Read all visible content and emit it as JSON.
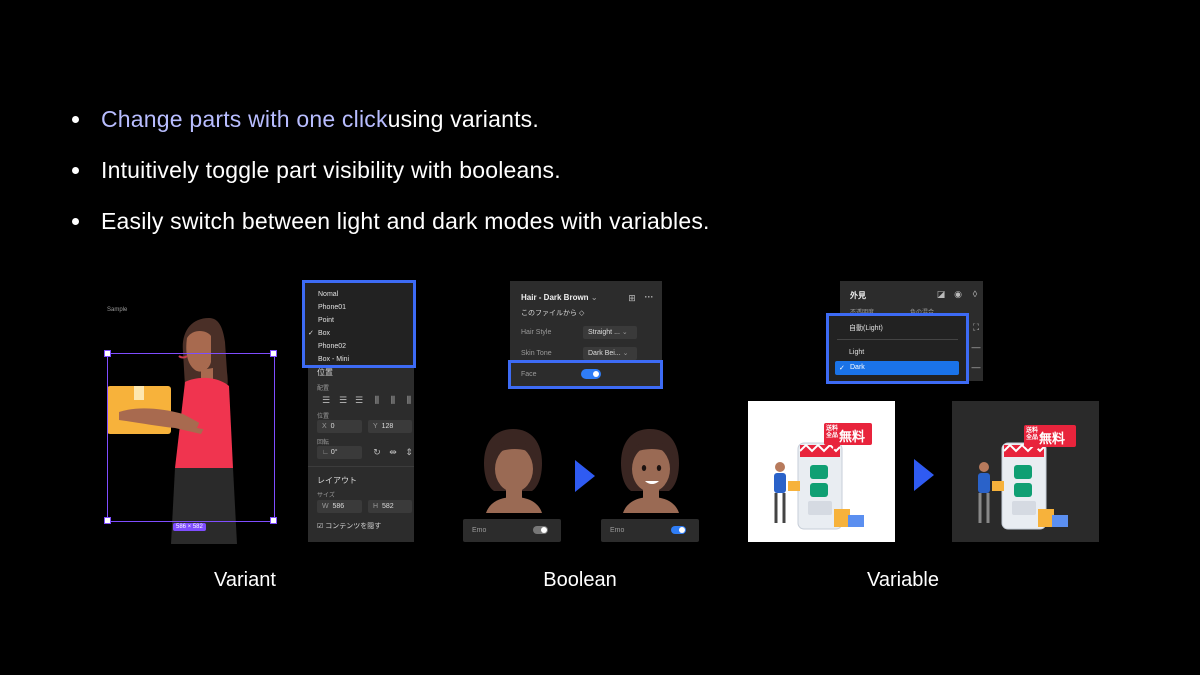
{
  "bullets": [
    {
      "highlight": "Change parts with one click",
      "rest": " using variants."
    },
    {
      "highlight": "",
      "rest": "Intuitively toggle part visibility with booleans."
    },
    {
      "highlight": "",
      "rest": "Easily switch between light and dark modes with variables."
    }
  ],
  "captions": {
    "variant": "Variant",
    "boolean": "Boolean",
    "variable": "Variable"
  },
  "variant": {
    "frame_label": "Sample",
    "size_badge": "586 × 582",
    "menu_items": [
      {
        "label": "Nomal",
        "checked": false
      },
      {
        "label": "Phone01",
        "checked": false
      },
      {
        "label": "Point",
        "checked": false
      },
      {
        "label": "Box",
        "checked": true
      },
      {
        "label": "Phone02",
        "checked": false
      },
      {
        "label": "Box - Mini",
        "checked": false
      }
    ],
    "check_mark": "✓",
    "position_title": "位置",
    "align_label": "配置",
    "pos_label": "位置",
    "x_label": "X",
    "x_value": "0",
    "y_label": "Y",
    "y_value": "128",
    "rotation_label": "回転",
    "rotation_value": "0°",
    "layout_title": "レイアウト",
    "size_label": "サイズ",
    "w_label": "W",
    "w_value": "586",
    "h_label": "H",
    "h_value": "582",
    "clip_label": "コンテンツを隠す"
  },
  "boolean": {
    "title": "Hair - Dark Brown",
    "from_file": "このファイルから",
    "hair_style_label": "Hair Style",
    "hair_style_value": "Straight ...",
    "skin_tone_label": "Skin Tone",
    "skin_tone_value": "Dark Bei...",
    "face_label": "Face",
    "emo_label": "Emo"
  },
  "variable": {
    "appearance_title": "外見",
    "opacity_label": "不透明度",
    "blend_label": "色の混合",
    "options": [
      {
        "label": "自動(Light)",
        "selected": false
      },
      {
        "label": "Light",
        "selected": false
      },
      {
        "label": "Dark",
        "selected": true
      }
    ],
    "check_mark": "✓",
    "badge_line1": "送料",
    "badge_line2": "全品",
    "badge_main": "無料"
  },
  "colors": {
    "accent": "#3d6bf5",
    "highlight_text": "#b8bdff",
    "toggle_on": "#2f7df6",
    "badge_red": "#e8243c",
    "selected_row": "#1a73e8"
  }
}
